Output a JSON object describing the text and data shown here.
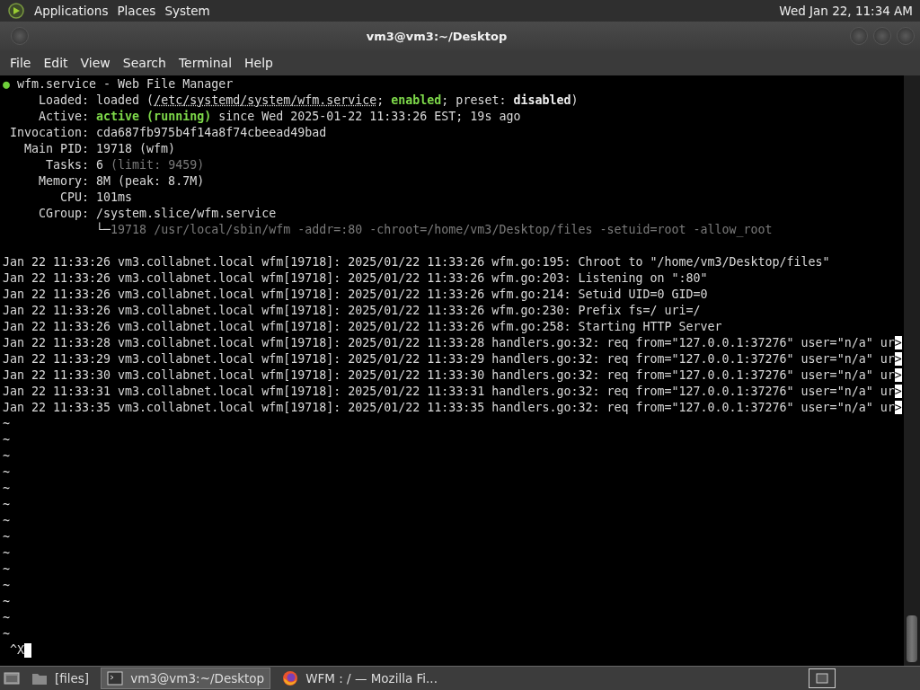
{
  "top_panel": {
    "menus": [
      "Applications",
      "Places",
      "System"
    ],
    "clock": "Wed Jan 22, 11:34 AM"
  },
  "window": {
    "title": "vm3@vm3:~/Desktop"
  },
  "menu_bar": [
    "File",
    "Edit",
    "View",
    "Search",
    "Terminal",
    "Help"
  ],
  "terminal": {
    "status_lines": [
      [
        {
          "text": "●",
          "kind": "green"
        },
        {
          "text": " wfm.service - Web File Manager",
          "kind": "plain"
        }
      ],
      [
        {
          "text": "     Loaded: loaded (",
          "kind": "plain"
        },
        {
          "text": "/etc/systemd/system/wfm.service",
          "kind": "underline"
        },
        {
          "text": "; ",
          "kind": "plain"
        },
        {
          "text": "enabled",
          "kind": "green-bold"
        },
        {
          "text": "; preset: ",
          "kind": "plain"
        },
        {
          "text": "disabled",
          "kind": "bold"
        },
        {
          "text": ")",
          "kind": "plain"
        }
      ],
      [
        {
          "text": "     Active: ",
          "kind": "plain"
        },
        {
          "text": "active (running)",
          "kind": "green-bold"
        },
        {
          "text": " since Wed 2025-01-22 11:33:26 EST; 19s ago",
          "kind": "plain"
        }
      ],
      [
        {
          "text": " Invocation: cda687fb975b4f14a8f74cbeead49bad",
          "kind": "plain"
        }
      ],
      [
        {
          "text": "   Main PID: 19718 (wfm)",
          "kind": "plain"
        }
      ],
      [
        {
          "text": "      Tasks: 6 ",
          "kind": "plain"
        },
        {
          "text": "(limit: 9459)",
          "kind": "dim"
        }
      ],
      [
        {
          "text": "     Memory: 8M (peak: 8.7M)",
          "kind": "plain"
        }
      ],
      [
        {
          "text": "        CPU: 101ms",
          "kind": "plain"
        }
      ],
      [
        {
          "text": "     CGroup: /system.slice/wfm.service",
          "kind": "plain"
        }
      ],
      [
        {
          "text": "             └─",
          "kind": "plain"
        },
        {
          "text": "19718 /usr/local/sbin/wfm -addr=:80 -chroot=/home/vm3/Desktop/files -setuid=root -allow_root",
          "kind": "dim"
        }
      ]
    ],
    "log_lines": [
      [
        {
          "text": "Jan 22 11:33:26 vm3.collabnet.local wfm[19718]: 2025/01/22 11:33:26 wfm.go:195: Chroot to \"/home/vm3/Desktop/files\"",
          "kind": "plain"
        }
      ],
      [
        {
          "text": "Jan 22 11:33:26 vm3.collabnet.local wfm[19718]: 2025/01/22 11:33:26 wfm.go:203: Listening on \":80\"",
          "kind": "plain"
        }
      ],
      [
        {
          "text": "Jan 22 11:33:26 vm3.collabnet.local wfm[19718]: 2025/01/22 11:33:26 wfm.go:214: Setuid UID=0 GID=0",
          "kind": "plain"
        }
      ],
      [
        {
          "text": "Jan 22 11:33:26 vm3.collabnet.local wfm[19718]: 2025/01/22 11:33:26 wfm.go:230: Prefix fs=/ uri=/",
          "kind": "plain"
        }
      ],
      [
        {
          "text": "Jan 22 11:33:26 vm3.collabnet.local wfm[19718]: 2025/01/22 11:33:26 wfm.go:258: Starting HTTP Server",
          "kind": "plain"
        }
      ],
      [
        {
          "text": "Jan 22 11:33:28 vm3.collabnet.local wfm[19718]: 2025/01/22 11:33:28 handlers.go:32: req from=\"127.0.0.1:37276\" user=\"n/a\" ur",
          "kind": "plain"
        },
        {
          "text": ">",
          "kind": "inverse"
        }
      ],
      [
        {
          "text": "Jan 22 11:33:29 vm3.collabnet.local wfm[19718]: 2025/01/22 11:33:29 handlers.go:32: req from=\"127.0.0.1:37276\" user=\"n/a\" ur",
          "kind": "plain"
        },
        {
          "text": ">",
          "kind": "inverse"
        }
      ],
      [
        {
          "text": "Jan 22 11:33:30 vm3.collabnet.local wfm[19718]: 2025/01/22 11:33:30 handlers.go:32: req from=\"127.0.0.1:37276\" user=\"n/a\" ur",
          "kind": "plain"
        },
        {
          "text": ">",
          "kind": "inverse"
        }
      ],
      [
        {
          "text": "Jan 22 11:33:31 vm3.collabnet.local wfm[19718]: 2025/01/22 11:33:31 handlers.go:32: req from=\"127.0.0.1:37276\" user=\"n/a\" ur",
          "kind": "plain"
        },
        {
          "text": ">",
          "kind": "inverse"
        }
      ],
      [
        {
          "text": "Jan 22 11:33:35 vm3.collabnet.local wfm[19718]: 2025/01/22 11:33:35 handlers.go:32: req from=\"127.0.0.1:37276\" user=\"n/a\" ur",
          "kind": "plain"
        },
        {
          "text": ">",
          "kind": "inverse"
        }
      ]
    ],
    "filler_lines": [
      [
        {
          "text": "~",
          "kind": "plain"
        }
      ],
      [
        {
          "text": "~",
          "kind": "plain"
        }
      ],
      [
        {
          "text": "~",
          "kind": "plain"
        }
      ],
      [
        {
          "text": "~",
          "kind": "plain"
        }
      ],
      [
        {
          "text": "~",
          "kind": "plain"
        }
      ],
      [
        {
          "text": "~",
          "kind": "plain"
        }
      ],
      [
        {
          "text": "~",
          "kind": "plain"
        }
      ],
      [
        {
          "text": "~",
          "kind": "plain"
        }
      ],
      [
        {
          "text": "~",
          "kind": "plain"
        }
      ],
      [
        {
          "text": "~",
          "kind": "plain"
        }
      ],
      [
        {
          "text": "~",
          "kind": "plain"
        }
      ],
      [
        {
          "text": "~",
          "kind": "plain"
        }
      ],
      [
        {
          "text": "~",
          "kind": "plain"
        }
      ],
      [
        {
          "text": "~",
          "kind": "plain"
        }
      ]
    ],
    "prompt": "^X"
  },
  "taskbar": {
    "items": [
      {
        "label": "[files]",
        "kind": "folder",
        "selected": false
      },
      {
        "label": "vm3@vm3:~/Desktop",
        "kind": "terminal",
        "selected": true
      },
      {
        "label": "WFM : / — Mozilla Fi...",
        "kind": "browser",
        "selected": false
      }
    ]
  }
}
